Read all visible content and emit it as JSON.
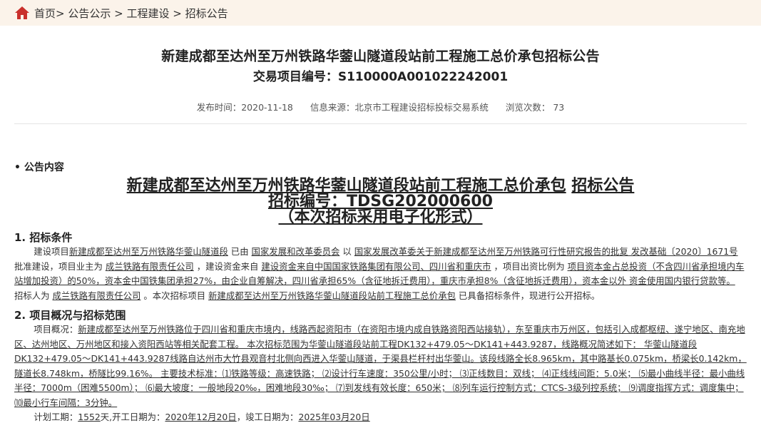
{
  "breadcrumb": {
    "home": "首页>",
    "sep1": " 公告公示 > ",
    "crumb2": "工程建设 > ",
    "crumb3": "招标公告"
  },
  "header": {
    "title": "新建成都至达州至万州铁路华蓥山隧道段站前工程施工总价承包招标公告",
    "code_label": "交易项目编号：S110000A001022242001",
    "publish": "发布时间：2020-11-18",
    "source": "信息来源：北京市工程建设招标投标交易系统",
    "views": "浏览次数： 73"
  },
  "section_label": "• 公告内容",
  "doc": {
    "title1": "新建成都至达州至万州铁路华蓥山隧道段站前工程施工总价承包",
    "title1b": "招标公告",
    "title2": "招标编号：TDSG202000600",
    "title3": "（本次招标采用电子化形式）",
    "h1": "1. 招标条件",
    "p1_a": "建设项目",
    "p1_b": "新建成都至达州至万州铁路华蓥山隧道段",
    "p1_c": " 已由 ",
    "p1_d": "国家发展和改革委员会",
    "p1_e": " 以 ",
    "p1_f": "国家发展改革委关于新建成都至达州至万州铁路可行性研究报告的批复 发改基础〔2020〕1671号",
    "p1_g": " 批准建设，项目业主为 ",
    "p1_h": "成兰铁路有限责任公司",
    "p1_i": " ，建设资金来自 ",
    "p1_j": "建设资金来自中国国家铁路集团有限公司、四川省和重庆市",
    "p1_k": " ，项目出资比例为 ",
    "p1_l": "项目资本金占总投资（不含四川省承担境内车站增加投资）的50%，资本金中国铁集团承担27%，由企业自筹解决，四川省承担65%（含征地拆迁费用），重庆市承担8%（含征地拆迁费用），资本金以外 资金使用国内银行贷款等。",
    "p1_m": " 招标人为 ",
    "p1_n": "成兰铁路有限责任公司",
    "p1_o": " 。本次招标项目 ",
    "p1_p": "新建成都至达州至万州铁路华蓥山隧道段站前工程施工总价承包",
    "p1_q": " 已具备招标条件，现进行公开招标。",
    "h2": "2. 项目概况与招标范围",
    "p2_a": "项目概况：",
    "p2_b": "新建成都至达州至万州铁路位于四川省和重庆市境内，线路西起资阳市（在资阳市境内成自铁路资阳西站接轨），东至重庆市万州区，包括引入成都枢纽、遂宁地区、南充地区、达州地区、万州地区和接入资阳西站等相关配套工程。 本次招标范围为华蓥山隧道段站前工程DK132+479.05～DK141+443.9287，线路概况简述如下： 华蓥山隧道段DK132+479.05～DK141+443.9287线路自达州市大竹县观音村北侧向西进入华蓥山隧道，于渠县栏杆村出华蓥山。该段线路全长8.965km，其中路基长0.075km，桥梁长0.142km，隧道长8.748km，桥隧比99.16%。 主要技术标准：⑴铁路等级：高速铁路； ⑵设计行车速度：350公里/小时； ⑶正线数目：双线； ⑷正线线间距：5.0米； ⑸最小曲线半径：最小曲线半径：7000m（困难5500m）； ⑹最大坡度：一般地段20‰，困难地段30‰； ⑺到发线有效长度：650米； ⑻列车运行控制方式：CTCS-3级列控系统； ⑼调度指挥方式：调度集中； ⑽最小行车间隔：3分钟。",
    "p3_a": "计划工期：",
    "p3_b": "1552",
    "p3_c": "天,开工日期为：",
    "p3_d": "2020年12月20日",
    "p3_e": "，竣工日期为：",
    "p3_f": "2025年03月20日"
  },
  "colors": {
    "accent": "#c9302c",
    "breadcrumb_bg": "#fbf3ea"
  }
}
